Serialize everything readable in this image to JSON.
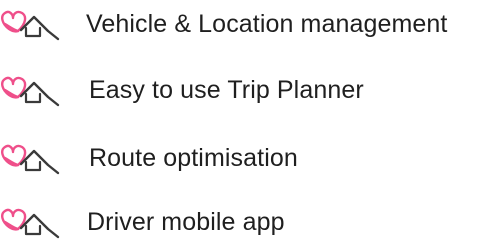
{
  "colors": {
    "accent_pink": "#ef4f8a",
    "icon_outline": "#3a3a3a",
    "text": "#1f1f1f"
  },
  "features": {
    "icon": "heart-house-icon",
    "items": [
      {
        "label": "Vehicle & Location management"
      },
      {
        "label": "Easy to use Trip Planner"
      },
      {
        "label": "Route optimisation"
      },
      {
        "label": "Driver mobile app"
      }
    ]
  }
}
